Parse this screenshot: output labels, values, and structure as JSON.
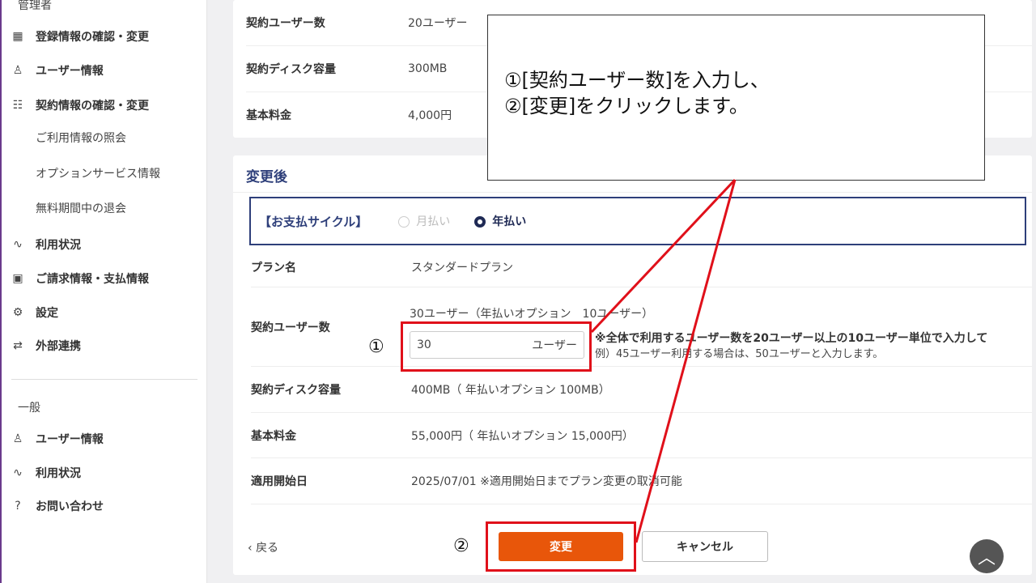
{
  "sidebar": {
    "admin_heading": "管理者",
    "items": [
      {
        "label": "登録情報の確認・変更",
        "icon": "building-icon"
      },
      {
        "label": "ユーザー情報",
        "icon": "user-icon"
      },
      {
        "label": "契約情報の確認・変更",
        "icon": "document-check-icon"
      },
      {
        "label": "利用状況",
        "icon": "activity-icon"
      },
      {
        "label": "ご請求情報・支払情報",
        "icon": "invoice-icon"
      },
      {
        "label": "設定",
        "icon": "gear-icon"
      },
      {
        "label": "外部連携",
        "icon": "integration-icon"
      }
    ],
    "subitems": [
      "ご利用情報の照会",
      "オプションサービス情報",
      "無料期間中の退会"
    ],
    "general_heading": "一般",
    "general_items": [
      {
        "label": "ユーザー情報",
        "icon": "user-icon"
      },
      {
        "label": "利用状況",
        "icon": "activity-icon"
      },
      {
        "label": "お問い合わせ",
        "icon": "help-chat-icon"
      }
    ]
  },
  "current": {
    "rows": [
      {
        "label": "契約ユーザー数",
        "value": "20ユーザー"
      },
      {
        "label": "契約ディスク容量",
        "value": "300MB"
      },
      {
        "label": "基本料金",
        "value": "4,000円"
      }
    ]
  },
  "after": {
    "title": "変更後",
    "cycle_label": "【お支払サイクル】",
    "cycle_monthly": "月払い",
    "cycle_yearly": "年払い",
    "plan_label": "プラン名",
    "plan_value": "スタンダードプラン",
    "users_label": "契約ユーザー数",
    "users_summary": "30ユーザー（年払いオプション　10ユーザー）",
    "users_input": "30",
    "users_unit": "ユーザー",
    "users_note": "※全体で利用するユーザー数を20ユーザー以上の10ユーザー単位で入力して",
    "users_example": "例）45ユーザー利用する場合は、50ユーザーと入力します。",
    "disk_label": "契約ディスク容量",
    "disk_value": "400MB（ 年払いオプション 100MB）",
    "fee_label": "基本料金",
    "fee_value": "55,000円（ 年払いオプション 15,000円）",
    "start_label": "適用開始日",
    "start_value": "2025/07/01 ※適用開始日までプラン変更の取消可能",
    "back": "戻る",
    "change": "変更",
    "cancel": "キャンセル"
  },
  "annotation": {
    "line1": "①[契約ユーザー数]を入力し、",
    "line2": "②[変更]をクリックします。",
    "marker1": "①",
    "marker2": "②",
    "color": "#e0101a"
  }
}
